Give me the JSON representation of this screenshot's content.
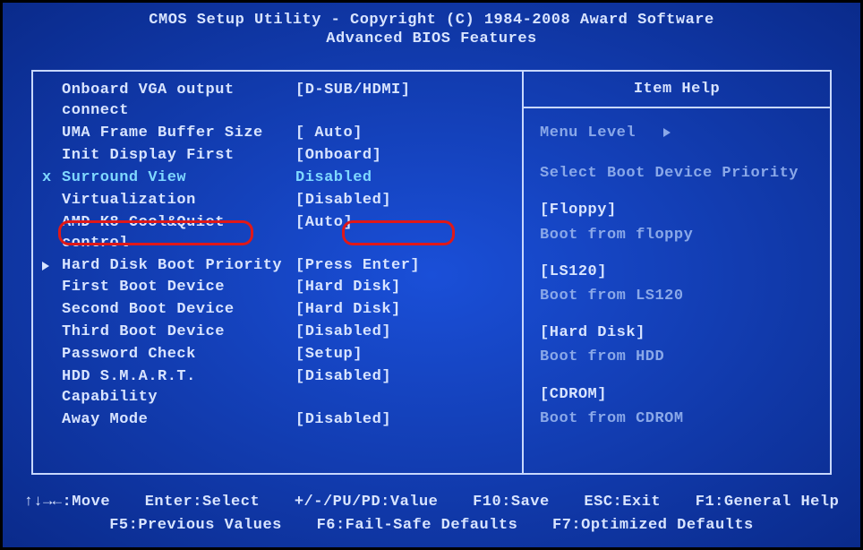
{
  "header": {
    "line1": "CMOS Setup Utility - Copyright (C) 1984-2008 Award Software",
    "line2": "Advanced BIOS Features"
  },
  "menu": {
    "items": [
      {
        "label": "Onboard VGA output connect",
        "value": "[D-SUB/HDMI]",
        "marker": ""
      },
      {
        "label": "UMA Frame Buffer Size",
        "value": "[  Auto]",
        "marker": ""
      },
      {
        "label": "Init Display First",
        "value": "[Onboard]",
        "marker": ""
      },
      {
        "label": "Surround View",
        "value": " Disabled",
        "marker": "x",
        "disabled": true
      },
      {
        "label": "Virtualization",
        "value": "[Disabled]",
        "marker": ""
      },
      {
        "label": "AMD K8 Cool&Quiet control",
        "value": "[Auto]",
        "marker": ""
      },
      {
        "label": "Hard Disk Boot Priority",
        "value": "[Press Enter]",
        "marker": "tri"
      },
      {
        "label": "First Boot Device",
        "value": "[Hard Disk]",
        "marker": "",
        "highlighted": true
      },
      {
        "label": "Second Boot Device",
        "value": "[Hard Disk]",
        "marker": ""
      },
      {
        "label": "Third Boot Device",
        "value": "[Disabled]",
        "marker": ""
      },
      {
        "label": "Password Check",
        "value": "[Setup]",
        "marker": ""
      },
      {
        "label": "HDD S.M.A.R.T. Capability",
        "value": "[Disabled]",
        "marker": ""
      },
      {
        "label": "Away Mode",
        "value": "[Disabled]",
        "marker": ""
      }
    ]
  },
  "help": {
    "title": "Item Help",
    "menu_level": "Menu Level",
    "desc": "Select Boot Device Priority",
    "options": [
      {
        "title": "[Floppy]",
        "desc": "Boot from floppy"
      },
      {
        "title": "[LS120]",
        "desc": "Boot from LS120"
      },
      {
        "title": "[Hard Disk]",
        "desc": "Boot from HDD"
      },
      {
        "title": "[CDROM]",
        "desc": "Boot from CDROM"
      }
    ]
  },
  "footer": {
    "line1": {
      "move": "↑↓→←:Move",
      "select": "Enter:Select",
      "value": "+/-/PU/PD:Value",
      "save": "F10:Save",
      "exit": "ESC:Exit",
      "genhelp": "F1:General Help"
    },
    "line2": {
      "prev": "F5:Previous Values",
      "failsafe": "F6:Fail-Safe Defaults",
      "optimized": "F7:Optimized Defaults"
    }
  }
}
